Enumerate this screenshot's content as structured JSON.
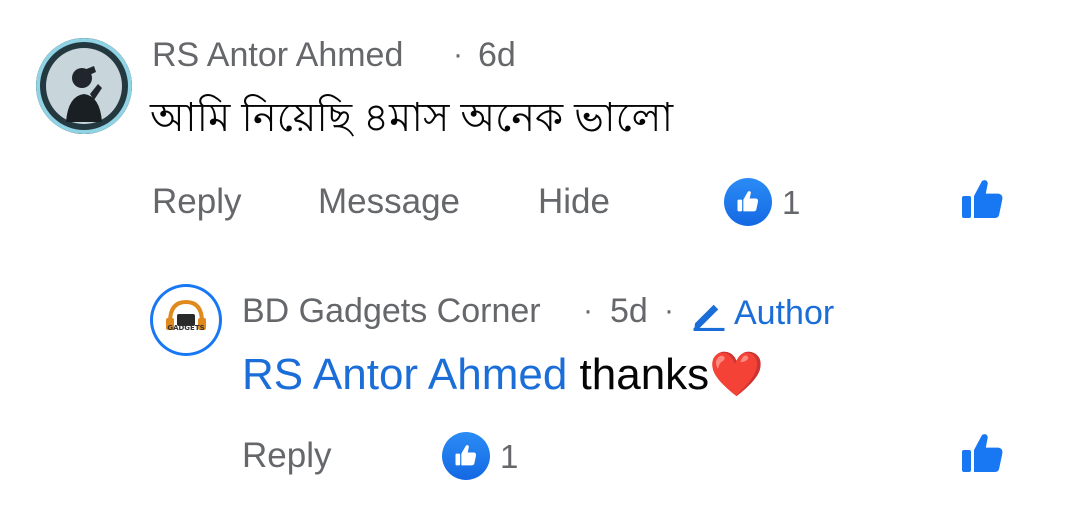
{
  "comment": {
    "author": "RS Antor Ahmed",
    "separator": "·",
    "time": "6d",
    "text": "আমি নিয়েছি ৪মাস অনেক ভালো",
    "actions": {
      "reply": "Reply",
      "message": "Message",
      "hide": "Hide"
    },
    "like_count": "1",
    "avatar_icon": "user-silhouette-icon"
  },
  "reply": {
    "author": "BD Gadgets Corner",
    "separator": "·",
    "time": "5d",
    "separator2": "·",
    "badge": "Author",
    "mention": "RS Antor Ahmed",
    "text": " thanks",
    "emoji": "❤️",
    "actions": {
      "reply": "Reply"
    },
    "like_count": "1",
    "avatar_text": "GADGETS",
    "avatar_icon": "headphones-logo-icon"
  },
  "colors": {
    "accent": "#1b6ed8",
    "meta": "#65676b",
    "text": "#050505"
  }
}
